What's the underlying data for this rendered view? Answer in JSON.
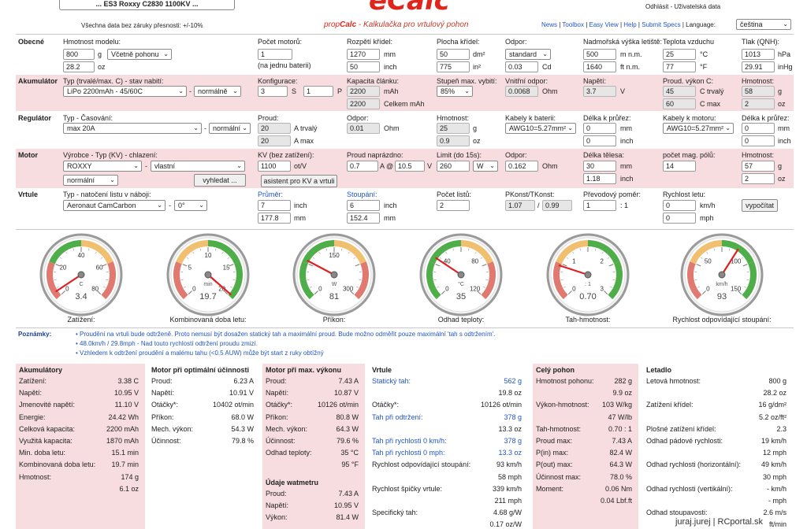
{
  "header": {
    "motor_title": "... ES3 Roxxy C2830 1100KV ...",
    "disclaimer": "Všechna data bez záruky přesnosti: +/-10%",
    "logo_text": "eCalc",
    "app_title_prop": "prop",
    "app_title_calc": "Calc",
    "app_title_rest": " - Kalkulačka pro vrtulový pohon",
    "user_links": "Odhlásit - Uživatelská data",
    "nav": [
      "News",
      "Toolbox",
      "Easy View",
      "Help",
      "Submit Specs"
    ],
    "language_label": "Language:",
    "language_value": "čeština"
  },
  "general": {
    "label": "Obecné",
    "weight_label": "Hmotnost modelu:",
    "weight_g": "800",
    "weight_unit_g": "g",
    "weight_mode": "Včetně pohonu",
    "weight_oz": "28.2",
    "weight_unit_oz": "oz",
    "motor_count_label": "Počet motorů:",
    "motor_count": "1",
    "motor_count_note": "(na jednu baterii)",
    "span_label": "Rozpětí křídel:",
    "span_mm": "1270",
    "span_unit_mm": "mm",
    "span_inch": "50",
    "span_unit_inch": "inch",
    "area_label": "Plocha křídel:",
    "area_dm2": "50",
    "area_unit_dm2": "dm²",
    "area_in2": "775",
    "area_unit_in2": "in²",
    "drag_label": "Odpor:",
    "drag_mode": "standard",
    "drag_cd": "0.03",
    "drag_unit": "Cd",
    "alt_label": "Nadmořská výška letiště:",
    "alt_m": "500",
    "alt_unit_m": "m n.m.",
    "alt_ft": "1640",
    "alt_unit_ft": "ft n.m.",
    "temp_label": "Teplota vzduchu",
    "temp_c": "25",
    "temp_unit_c": "°C",
    "temp_f": "77",
    "temp_unit_f": "°F",
    "pressure_label": "Tlak (QNH):",
    "pressure_hpa": "1013",
    "pressure_unit_hpa": "hPa",
    "pressure_inhg": "29.91",
    "pressure_unit_inhg": "inHg"
  },
  "battery": {
    "label": "Akumulátor",
    "type_label": "Typ (trvalé/max. C) - stav nabití:",
    "type_value": "LiPo 2200mAh - 45/60C",
    "charge_state": "normálně",
    "config_label": "Konfigurace:",
    "config_s": "3",
    "config_s_unit": "S",
    "config_p": "1",
    "config_p_unit": "P",
    "capacity_label": "Kapacita článku:",
    "capacity_cell": "2200",
    "capacity_unit": "mAh",
    "capacity_total": "2200",
    "capacity_total_unit": "Celkem mAh",
    "discharge_label": "Stupeň max. vybití:",
    "discharge_value": "85%",
    "resistance_label": "Vnitřní odpor:",
    "resistance_value": "0.0068",
    "resistance_unit": "Ohm",
    "voltage_label": "Napětí:",
    "voltage_value": "3.7",
    "voltage_unit": "V",
    "current_label": "Proud. výkon C:",
    "c_cont": "45",
    "c_cont_unit": "C trvalý",
    "c_max": "60",
    "c_max_unit": "C max",
    "mass_label": "Hmotnost:",
    "mass_g": "58",
    "mass_unit_g": "g",
    "mass_oz": "2",
    "mass_unit_oz": "oz"
  },
  "esc": {
    "label": "Regulátor",
    "type_label": "Typ - Časování:",
    "type_value": "max 20A",
    "timing": "normální",
    "current_label": "Proud:",
    "current_cont": "20",
    "current_cont_unit": "A trvalý",
    "current_max": "20",
    "current_max_unit": "A max",
    "resistance_label": "Odpor:",
    "resistance_value": "0.01",
    "resistance_unit": "Ohm",
    "weight_label": "Hmotnost:",
    "weight_g": "25",
    "weight_unit_g": "g",
    "weight_oz": "0.9",
    "weight_unit_oz": "oz",
    "cable_batt_label": "Kabely k baterii:",
    "cable_batt_value": "AWG10=5.27mm²",
    "cable_batt_len_label": "Délka k průřez:",
    "cable_batt_len_mm": "0",
    "cable_batt_len_unit_mm": "mm",
    "cable_batt_len_in": "0",
    "cable_batt_len_unit_in": "inch",
    "cable_motor_label": "Kabely k motoru:",
    "cable_motor_value": "AWG10=5.27mm²",
    "cable_motor_len_label": "Délka k průřez:",
    "cable_motor_len_mm": "0",
    "cable_motor_len_unit_mm": "mm",
    "cable_motor_len_in": "0",
    "cable_motor_len_unit_in": "inch"
  },
  "motor": {
    "label": "Motor",
    "maker_label": "Výrobce - Typ (KV) - chlazení:",
    "maker_value": "ROXXY",
    "type_value": "vlastní",
    "cooling_value": "normální",
    "search_button": "vyhledat ...",
    "kv_label": "KV (bez zatížení):",
    "kv_value": "1100",
    "kv_unit": "ot/V",
    "kv_assist_button": "asistent pro KV a vrtuli",
    "noload_label": "Proud naprázdno:",
    "noload_a": "0.7",
    "noload_at": "A @",
    "noload_v": "10.5",
    "noload_v_unit": "V",
    "limit_label": "Limit (do 15s):",
    "limit_value": "260",
    "limit_unit": "W",
    "resistance_label": "Odpor:",
    "resistance_value": "0.162",
    "resistance_unit": "Ohm",
    "length_label": "Délka tělesa:",
    "length_mm": "30",
    "length_unit_mm": "mm",
    "length_in": "1.18",
    "length_unit_in": "inch",
    "poles_label": "počet mag. pólů:",
    "poles_value": "14",
    "mass_label": "Hmotnost:",
    "mass_g": "57",
    "mass_unit_g": "g",
    "mass_oz": "2",
    "mass_unit_oz": "oz"
  },
  "prop": {
    "label": "Vrtule",
    "type_label": "Typ - natočení listu v náboji:",
    "type_value": "Aeronaut CamCarbon",
    "pitch_angle": "0°",
    "diameter_label": "Průměr:",
    "diameter_in": "7",
    "diameter_unit_in": "inch",
    "diameter_mm": "177.8",
    "diameter_unit_mm": "mm",
    "pitch_label": "Stoupání:",
    "pitch_in": "6",
    "pitch_unit_in": "inch",
    "pitch_mm": "152.4",
    "pitch_unit_mm": "mm",
    "blades_label": "Počet listů:",
    "blades_value": "2",
    "pconst_label": "PKonst/TKonst:",
    "pconst_value": "1.07",
    "pconst_sep": "/",
    "tconst_value": "0.99",
    "gear_label": "Převodový poměr:",
    "gear_value": "1",
    "gear_sep": ": 1",
    "speed_label": "Rychlost letu:",
    "speed_kmh": "0",
    "speed_unit_kmh": "km/h",
    "speed_mph": "0",
    "speed_unit_mph": "mph",
    "calc_button": "vypočítat"
  },
  "gauges": [
    {
      "title": "Zatížení:",
      "value": "3.4",
      "unit": "C",
      "ticks": [
        "20",
        "40",
        "60",
        "0",
        "80"
      ],
      "min": 0,
      "max": 80,
      "reading": 3.4,
      "zones": [
        "red",
        "green",
        "yellow",
        "red"
      ]
    },
    {
      "title": "Kombinovaná doba letu:",
      "value": "19.7",
      "unit": "min",
      "ticks": [
        "5",
        "10",
        "15",
        "0",
        "20"
      ],
      "min": 0,
      "max": 20,
      "reading": 19.7,
      "zones": [
        "red",
        "yellow",
        "green",
        "green"
      ]
    },
    {
      "title": "Příkon:",
      "value": "81",
      "unit": "W",
      "ticks": [
        "150",
        "0",
        "300"
      ],
      "min": 0,
      "max": 300,
      "reading": 81,
      "zones": [
        "green",
        "green",
        "yellow",
        "red"
      ]
    },
    {
      "title": "Odhad teploty:",
      "value": "35",
      "unit": "°C",
      "ticks": [
        "40",
        "80",
        "0",
        "120"
      ],
      "min": 0,
      "max": 120,
      "reading": 35,
      "zones": [
        "green",
        "green",
        "yellow",
        "red"
      ]
    },
    {
      "title": "Tah-hmotnost:",
      "value": "0.70",
      "unit": ": 1",
      "ticks": [
        "1",
        "2",
        "0",
        "3"
      ],
      "min": 0,
      "max": 3,
      "reading": 0.7,
      "zones": [
        "red",
        "yellow",
        "green",
        "green"
      ]
    },
    {
      "title": "Rychlost odpovídající stoupání:",
      "value": "93",
      "unit": "km/h",
      "ticks": [
        "50",
        "100",
        "0",
        "150"
      ],
      "min": 0,
      "max": 150,
      "reading": 93,
      "zones": [
        "red",
        "yellow",
        "green",
        "green"
      ]
    }
  ],
  "notes": {
    "label": "Poznámky:",
    "items": [
      "Proudění na vrtuli bude odtrženě. Proto nemusí být dosažen statický tah a maximální proud. Bude možno odměřit pouze maximální 'tah s odtržením'.",
      "48.0km/h / 29.8mph - Nad touto rychlostí odtržení proudu zmizí.",
      "Vzhledem k odtržení proudění a malému tahu (<0.5 AUW) může být start z ruky obtížný"
    ]
  },
  "results": {
    "battery": {
      "title": "Akumulátory",
      "rows": [
        [
          "Zatížení:",
          "3.38 C"
        ],
        [
          "Napětí:",
          "10.95 V"
        ],
        [
          "Jmenovité napětí:",
          "11.10 V"
        ],
        [
          "Energie:",
          "24.42 Wh"
        ],
        [
          "Celková kapacita:",
          "2200 mAh"
        ],
        [
          "Využitá kapacita:",
          "1870 mAh"
        ],
        [
          "Min. doba letu:",
          "15.1 min"
        ],
        [
          "Kombinovaná doba letu:",
          "19.7 min"
        ],
        [
          "Hmotnost:",
          "174 g"
        ],
        [
          "",
          "6.1 oz"
        ]
      ]
    },
    "motor_eff": {
      "title": "Motor při optimální účinnosti",
      "rows": [
        [
          "Proud:",
          "6.23 A"
        ],
        [
          "Napětí:",
          "10.91 V"
        ],
        [
          "Otáčky*:",
          "10402 ot/min"
        ],
        [
          "Příkon:",
          "68.0 W"
        ],
        [
          "Mech. výkon:",
          "54.3 W"
        ],
        [
          "Účinnost:",
          "79.8 %"
        ]
      ]
    },
    "motor_max": {
      "title": "Motor při max. výkonu",
      "rows": [
        [
          "Proud:",
          "7.43 A"
        ],
        [
          "Napětí:",
          "10.87 V"
        ],
        [
          "Otáčky*:",
          "10126 ot/min"
        ],
        [
          "Příkon:",
          "80.8 W"
        ],
        [
          "Mech. výkon:",
          "64.3 W"
        ],
        [
          "Účinnost:",
          "79.6 %"
        ],
        [
          "Odhad teploty:",
          "35 °C"
        ],
        [
          "",
          "95 °F"
        ]
      ],
      "wattmeter_title": "Údaje watmetru",
      "wattmeter_rows": [
        [
          "Proud:",
          "7.43 A"
        ],
        [
          "Napětí:",
          "10.95 V"
        ],
        [
          "Výkon:",
          "81.4 W"
        ]
      ]
    },
    "prop": {
      "title": "Vrtule",
      "rows": [
        [
          "Statický tah:",
          "562 g",
          true
        ],
        [
          "",
          "19.8 oz",
          false
        ],
        [
          "Otáčky*:",
          "10126 ot/min",
          false
        ],
        [
          "Tah při odtržení:",
          "378 g",
          true
        ],
        [
          "",
          "13.3 oz",
          false
        ],
        [
          "Tah při rychlosti 0 km/h:",
          "378 g",
          true
        ],
        [
          "Tah při rychlosti 0 mph:",
          "13.3 oz",
          true
        ],
        [
          "Rychlost odpovídající stoupání:",
          "93 km/h",
          false
        ],
        [
          "",
          "58 mph",
          false
        ],
        [
          "Rychlost špičky vrtule:",
          "339 km/h",
          false
        ],
        [
          "",
          "211 mph",
          false
        ],
        [
          "Specifický tah:",
          "4.68 g/W",
          false
        ],
        [
          "",
          "0.17 oz/W",
          false
        ]
      ]
    },
    "drive": {
      "title": "Celý pohon",
      "rows": [
        [
          "Hmotnost pohonu:",
          "282 g"
        ],
        [
          "",
          "9.9 oz"
        ],
        [
          "Výkon-hmotnost:",
          "103 W/kg"
        ],
        [
          "",
          "47 W/lb"
        ],
        [
          "Tah-hmotnost:",
          "0.70 : 1"
        ],
        [
          "Proud max:",
          "7.43 A"
        ],
        [
          "P(in) max:",
          "82.4 W"
        ],
        [
          "P(out) max:",
          "64.3 W"
        ],
        [
          "Účinnost max:",
          "78.0 %"
        ],
        [
          "Moment:",
          "0.06 Nm"
        ],
        [
          "",
          "0.04 Lbf.ft"
        ]
      ]
    },
    "flight": {
      "title": "Letadlo",
      "rows": [
        [
          "Letová hmotnost:",
          "800 g"
        ],
        [
          "",
          "28.2 oz"
        ],
        [
          "Zatížení křídel:",
          "16 g/dm²"
        ],
        [
          "",
          "5.2 oz/ft²"
        ],
        [
          "Plošné zatížení křídel:",
          "2.3"
        ],
        [
          "Odhad pádové rychlosti:",
          "19 km/h"
        ],
        [
          "",
          "12 mph"
        ],
        [
          "Odhad rychlosti (horizontální):",
          "49 km/h"
        ],
        [
          "",
          "30 mph"
        ],
        [
          "Odhad rychlosti (vertikální):",
          "- km/h"
        ],
        [
          "",
          "- mph"
        ],
        [
          "Odhad stoupavosti:",
          "2.6 m/s"
        ],
        [
          "",
          "ft/min"
        ]
      ]
    }
  },
  "footer": {
    "credit": "juraj.jurej | RCportal.sk"
  }
}
